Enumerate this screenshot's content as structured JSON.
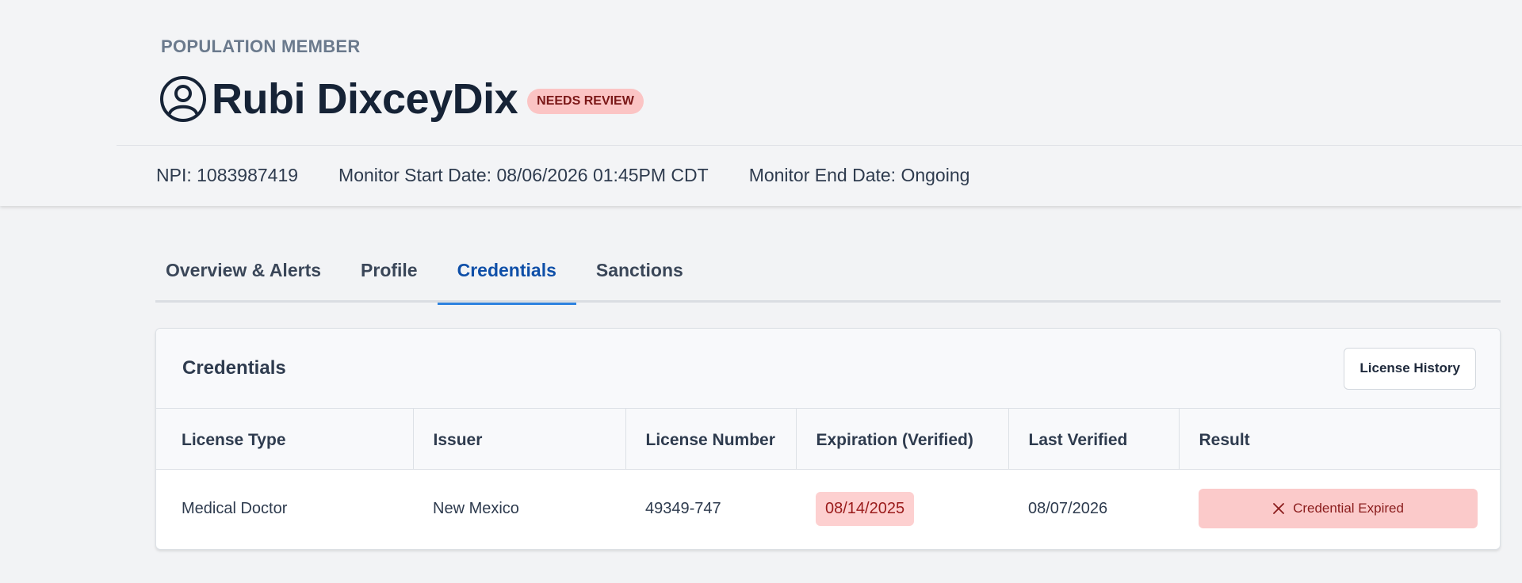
{
  "header": {
    "eyebrow": "POPULATION MEMBER",
    "member_name": "Rubi DixceyDix",
    "status_badge": "NEEDS REVIEW",
    "meta": {
      "npi": "NPI: 1083987419",
      "monitor_start": "Monitor Start Date: 08/06/2026 01:45PM CDT",
      "monitor_end": "Monitor End Date: Ongoing"
    }
  },
  "tabs": [
    {
      "label": "Overview & Alerts",
      "active": false
    },
    {
      "label": "Profile",
      "active": false
    },
    {
      "label": "Credentials",
      "active": true
    },
    {
      "label": "Sanctions",
      "active": false
    }
  ],
  "credentials": {
    "title": "Credentials",
    "history_button": "License History",
    "columns": [
      "License Type",
      "Issuer",
      "License Number",
      "Expiration (Verified)",
      "Last Verified",
      "Result"
    ],
    "rows": [
      {
        "license_type": "Medical Doctor",
        "issuer": "New Mexico",
        "license_number": "49349-747",
        "expiration": "08/14/2025",
        "last_verified": "08/07/2026",
        "result": "Credential Expired"
      }
    ]
  },
  "icons": {
    "avatar": "user-circle-icon",
    "result": "close-icon"
  },
  "colors": {
    "accent": "#0f4fa8",
    "tab_underline": "#2f83e0",
    "badge_bg": "#fbc4c4",
    "badge_text": "#7a1717",
    "expired_bg": "#fbcaca"
  }
}
